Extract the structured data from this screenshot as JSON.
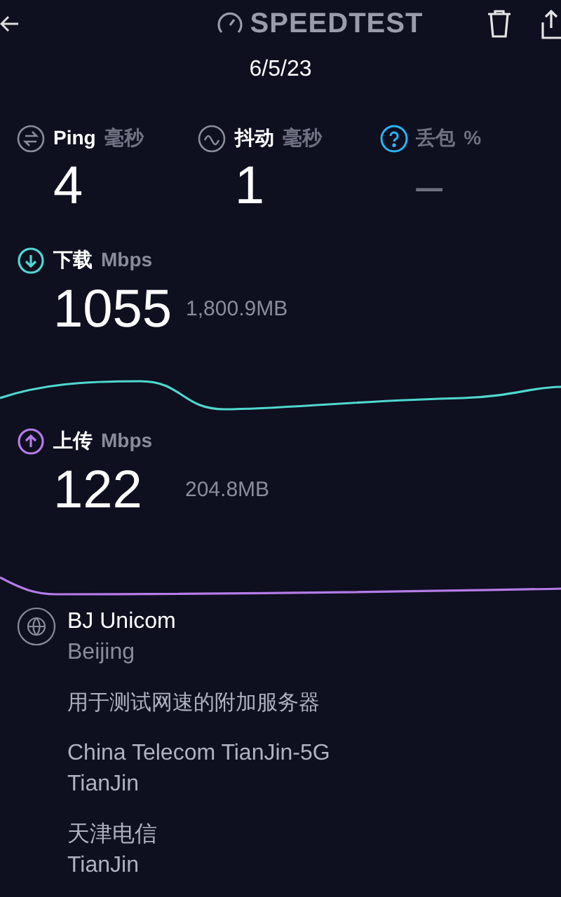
{
  "header": {
    "title": "SPEEDTEST"
  },
  "date": "6/5/23",
  "metrics": [
    {
      "kind": "ping",
      "label": "Ping",
      "unit": "毫秒",
      "value": "4",
      "dimmed": false
    },
    {
      "kind": "jitter",
      "label": "抖动",
      "unit": "毫秒",
      "value": "1",
      "dimmed": false
    },
    {
      "kind": "loss",
      "label": "丢包",
      "unit": "%",
      "value": "–",
      "dimmed": true
    }
  ],
  "speeds": [
    {
      "kind": "download",
      "label": "下载",
      "unit": "Mbps",
      "value": "1055",
      "data_used": "1,800.9MB",
      "color": "#4fd8d0"
    },
    {
      "kind": "upload",
      "label": "上传",
      "unit": "Mbps",
      "value": "122",
      "data_used": "204.8MB",
      "color": "#b57be8"
    }
  ],
  "server": {
    "name": "BJ Unicom",
    "location": "Beijing"
  },
  "additional_servers": {
    "heading": "用于测试网速的附加服务器",
    "items": [
      {
        "name": "China Telecom TianJin-5G",
        "location": "TianJin"
      },
      {
        "name": "天津电信",
        "location": "TianJin"
      }
    ]
  }
}
